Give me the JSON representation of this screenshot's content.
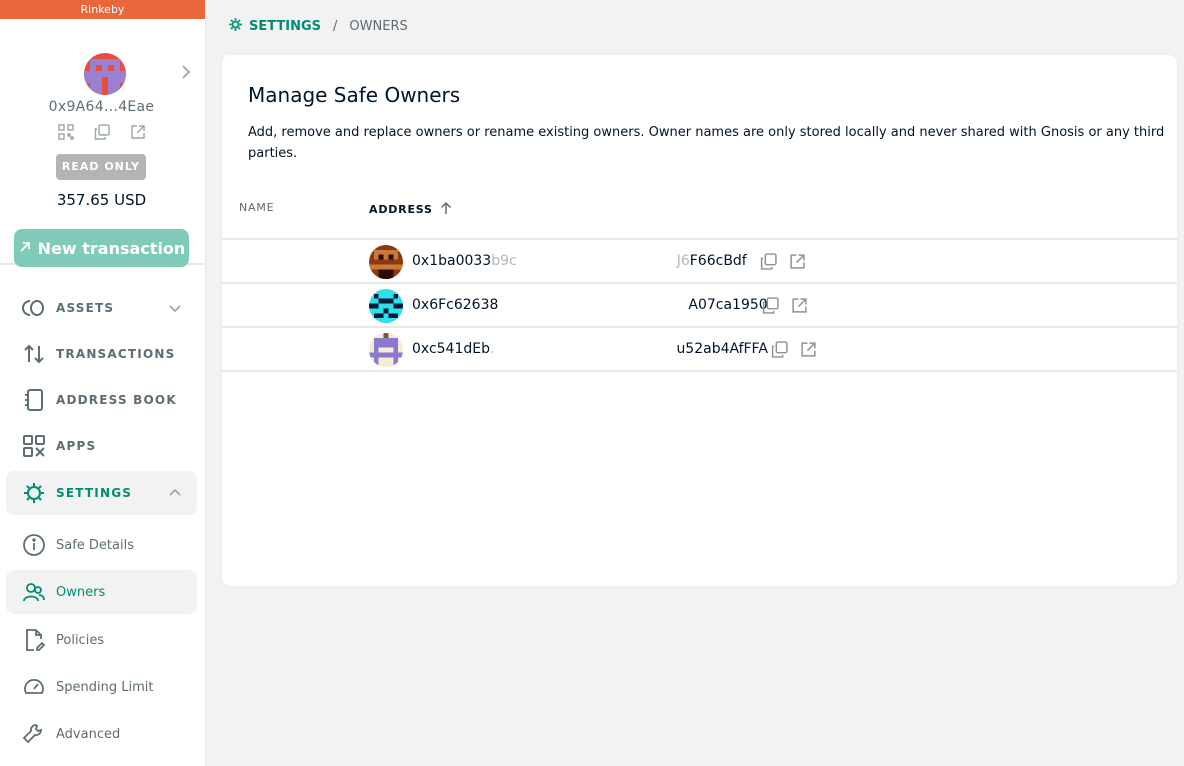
{
  "network": {
    "name": "Rinkeby"
  },
  "safe": {
    "address": "0x9A64...4Eae",
    "mode": "READ ONLY",
    "balance": "357.65 USD",
    "new_transaction_label": "New transaction"
  },
  "nav": {
    "items": [
      {
        "label": "ASSETS",
        "icon": "assets-icon"
      },
      {
        "label": "TRANSACTIONS",
        "icon": "transactions-icon"
      },
      {
        "label": "ADDRESS BOOK",
        "icon": "address-book-icon"
      },
      {
        "label": "APPS",
        "icon": "apps-icon"
      },
      {
        "label": "SETTINGS",
        "icon": "gear-icon"
      }
    ],
    "settings_sub": [
      {
        "label": "Safe Details",
        "icon": "info-icon"
      },
      {
        "label": "Owners",
        "icon": "owners-icon"
      },
      {
        "label": "Policies",
        "icon": "policies-icon"
      },
      {
        "label": "Spending Limit",
        "icon": "gauge-icon"
      },
      {
        "label": "Advanced",
        "icon": "wrench-icon"
      }
    ]
  },
  "breadcrumb": {
    "section": "SETTINGS",
    "separator": "/",
    "page": "OWNERS"
  },
  "owners": {
    "title": "Manage Safe Owners",
    "description": "Add, remove and replace owners or rename existing owners. Owner names are only stored locally and never shared with Gnosis or any third parties.",
    "col_name": "NAME",
    "col_address": "ADDRESS",
    "rows": [
      {
        "addr_start": "0x1ba0033",
        "addr_start_faded": "b9c",
        "addr_end_faded": "J6",
        "addr_end": "F66cBdf"
      },
      {
        "addr_start": "0x6Fc62638",
        "addr_start_faded": "",
        "addr_end_faded": "",
        "addr_end": "A07ca1950"
      },
      {
        "addr_start": "0xc541dEb",
        "addr_start_faded": ".",
        "addr_end_faded": "",
        "addr_end": "u52ab4AfFFA"
      }
    ]
  },
  "colors": {
    "accent": "#008c73",
    "network_bar": "#e8673c",
    "new_tx_button": "#7fcab8",
    "readonly_badge": "#b2b5b2"
  }
}
